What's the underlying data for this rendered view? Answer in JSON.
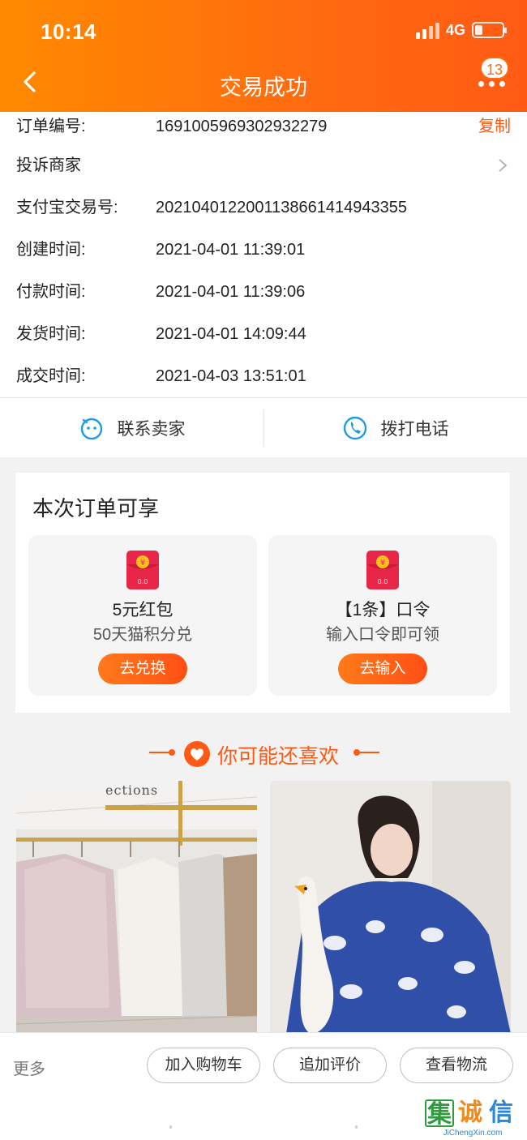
{
  "status_bar": {
    "time": "10:14",
    "network": "4G"
  },
  "header": {
    "title": "交易成功",
    "badge_count": "13"
  },
  "order_info": {
    "rows": [
      {
        "label": "订单编号:",
        "value": "1691005969302932279",
        "action": "复制"
      },
      {
        "label": "投诉商家",
        "value": ""
      },
      {
        "label": "支付宝交易号:",
        "value": "2021040122001138661414943355"
      },
      {
        "label": "创建时间:",
        "value": "2021-04-01 11:39:01"
      },
      {
        "label": "付款时间:",
        "value": "2021-04-01 11:39:06"
      },
      {
        "label": "发货时间:",
        "value": "2021-04-01 14:09:44"
      },
      {
        "label": "成交时间:",
        "value": "2021-04-03 13:51:01"
      }
    ]
  },
  "contact": {
    "seller_label": "联系卖家",
    "phone_label": "拨打电话"
  },
  "benefits": {
    "title": "本次订单可享",
    "cards": [
      {
        "name": "5元红包",
        "desc": "50天猫积分兑",
        "button": "去兑换"
      },
      {
        "name": "【1条】口令",
        "desc": "输入口令即可领",
        "button": "去输入"
      }
    ]
  },
  "recommend": {
    "title": "你可能还喜欢",
    "photo_text": "ections"
  },
  "bottom_bar": {
    "more": "更多",
    "buttons": [
      "加入购物车",
      "追加评价",
      "查看物流"
    ]
  },
  "watermark": {
    "chars": [
      "集",
      "诚",
      "信"
    ],
    "url": "JiChengXin.com"
  }
}
